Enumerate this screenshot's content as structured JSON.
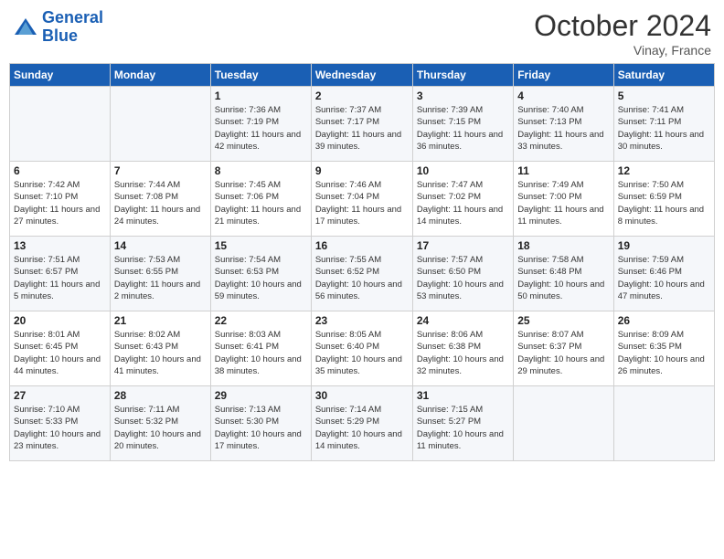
{
  "header": {
    "logo_line1": "General",
    "logo_line2": "Blue",
    "month": "October 2024",
    "location": "Vinay, France"
  },
  "days_of_week": [
    "Sunday",
    "Monday",
    "Tuesday",
    "Wednesday",
    "Thursday",
    "Friday",
    "Saturday"
  ],
  "weeks": [
    [
      {
        "day": "",
        "info": ""
      },
      {
        "day": "",
        "info": ""
      },
      {
        "day": "1",
        "info": "Sunrise: 7:36 AM\nSunset: 7:19 PM\nDaylight: 11 hours and 42 minutes."
      },
      {
        "day": "2",
        "info": "Sunrise: 7:37 AM\nSunset: 7:17 PM\nDaylight: 11 hours and 39 minutes."
      },
      {
        "day": "3",
        "info": "Sunrise: 7:39 AM\nSunset: 7:15 PM\nDaylight: 11 hours and 36 minutes."
      },
      {
        "day": "4",
        "info": "Sunrise: 7:40 AM\nSunset: 7:13 PM\nDaylight: 11 hours and 33 minutes."
      },
      {
        "day": "5",
        "info": "Sunrise: 7:41 AM\nSunset: 7:11 PM\nDaylight: 11 hours and 30 minutes."
      }
    ],
    [
      {
        "day": "6",
        "info": "Sunrise: 7:42 AM\nSunset: 7:10 PM\nDaylight: 11 hours and 27 minutes."
      },
      {
        "day": "7",
        "info": "Sunrise: 7:44 AM\nSunset: 7:08 PM\nDaylight: 11 hours and 24 minutes."
      },
      {
        "day": "8",
        "info": "Sunrise: 7:45 AM\nSunset: 7:06 PM\nDaylight: 11 hours and 21 minutes."
      },
      {
        "day": "9",
        "info": "Sunrise: 7:46 AM\nSunset: 7:04 PM\nDaylight: 11 hours and 17 minutes."
      },
      {
        "day": "10",
        "info": "Sunrise: 7:47 AM\nSunset: 7:02 PM\nDaylight: 11 hours and 14 minutes."
      },
      {
        "day": "11",
        "info": "Sunrise: 7:49 AM\nSunset: 7:00 PM\nDaylight: 11 hours and 11 minutes."
      },
      {
        "day": "12",
        "info": "Sunrise: 7:50 AM\nSunset: 6:59 PM\nDaylight: 11 hours and 8 minutes."
      }
    ],
    [
      {
        "day": "13",
        "info": "Sunrise: 7:51 AM\nSunset: 6:57 PM\nDaylight: 11 hours and 5 minutes."
      },
      {
        "day": "14",
        "info": "Sunrise: 7:53 AM\nSunset: 6:55 PM\nDaylight: 11 hours and 2 minutes."
      },
      {
        "day": "15",
        "info": "Sunrise: 7:54 AM\nSunset: 6:53 PM\nDaylight: 10 hours and 59 minutes."
      },
      {
        "day": "16",
        "info": "Sunrise: 7:55 AM\nSunset: 6:52 PM\nDaylight: 10 hours and 56 minutes."
      },
      {
        "day": "17",
        "info": "Sunrise: 7:57 AM\nSunset: 6:50 PM\nDaylight: 10 hours and 53 minutes."
      },
      {
        "day": "18",
        "info": "Sunrise: 7:58 AM\nSunset: 6:48 PM\nDaylight: 10 hours and 50 minutes."
      },
      {
        "day": "19",
        "info": "Sunrise: 7:59 AM\nSunset: 6:46 PM\nDaylight: 10 hours and 47 minutes."
      }
    ],
    [
      {
        "day": "20",
        "info": "Sunrise: 8:01 AM\nSunset: 6:45 PM\nDaylight: 10 hours and 44 minutes."
      },
      {
        "day": "21",
        "info": "Sunrise: 8:02 AM\nSunset: 6:43 PM\nDaylight: 10 hours and 41 minutes."
      },
      {
        "day": "22",
        "info": "Sunrise: 8:03 AM\nSunset: 6:41 PM\nDaylight: 10 hours and 38 minutes."
      },
      {
        "day": "23",
        "info": "Sunrise: 8:05 AM\nSunset: 6:40 PM\nDaylight: 10 hours and 35 minutes."
      },
      {
        "day": "24",
        "info": "Sunrise: 8:06 AM\nSunset: 6:38 PM\nDaylight: 10 hours and 32 minutes."
      },
      {
        "day": "25",
        "info": "Sunrise: 8:07 AM\nSunset: 6:37 PM\nDaylight: 10 hours and 29 minutes."
      },
      {
        "day": "26",
        "info": "Sunrise: 8:09 AM\nSunset: 6:35 PM\nDaylight: 10 hours and 26 minutes."
      }
    ],
    [
      {
        "day": "27",
        "info": "Sunrise: 7:10 AM\nSunset: 5:33 PM\nDaylight: 10 hours and 23 minutes."
      },
      {
        "day": "28",
        "info": "Sunrise: 7:11 AM\nSunset: 5:32 PM\nDaylight: 10 hours and 20 minutes."
      },
      {
        "day": "29",
        "info": "Sunrise: 7:13 AM\nSunset: 5:30 PM\nDaylight: 10 hours and 17 minutes."
      },
      {
        "day": "30",
        "info": "Sunrise: 7:14 AM\nSunset: 5:29 PM\nDaylight: 10 hours and 14 minutes."
      },
      {
        "day": "31",
        "info": "Sunrise: 7:15 AM\nSunset: 5:27 PM\nDaylight: 10 hours and 11 minutes."
      },
      {
        "day": "",
        "info": ""
      },
      {
        "day": "",
        "info": ""
      }
    ]
  ]
}
